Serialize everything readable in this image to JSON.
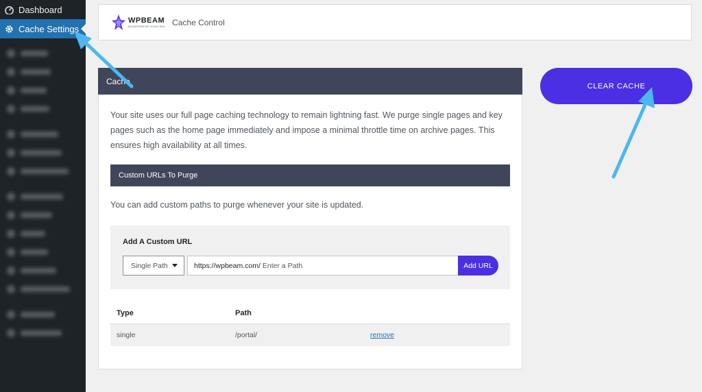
{
  "sidebar": {
    "items": [
      {
        "label": "Dashboard",
        "icon": "dashboard-icon"
      },
      {
        "label": "Cache Settings",
        "icon": "gear-icon",
        "active": true
      }
    ]
  },
  "header": {
    "logo_word": "WPBEAM",
    "logo_tagline": "WORDPRESS HOSTING",
    "title": "Cache Control"
  },
  "panel": {
    "heading": "Cache",
    "intro": "Your site uses our full page caching technology to remain lightning fast. We purge single pages and key pages such as the home page immediately and impose a minimal throttle time on archive pages. This ensures high availability at all times.",
    "custom_heading": "Custom URLs To Purge",
    "custom_text": "You can add custom paths to purge whenever your site is updated.",
    "add": {
      "title": "Add A Custom URL",
      "select_value": "Single Path",
      "url_prefix": "https://wpbeam.com/",
      "placeholder": "Enter a Path",
      "button": "Add URL"
    },
    "table": {
      "headers": [
        "Type",
        "Path"
      ],
      "rows": [
        {
          "type": "single",
          "path": "/portal/",
          "action": "remove"
        }
      ]
    }
  },
  "clear_cache": "CLEAR CACHE",
  "colors": {
    "accent": "#4b2fe3",
    "sidebar": "#1d2327",
    "active": "#2271b1",
    "panel_head": "#40465a",
    "arrow": "#4cb7f0"
  }
}
